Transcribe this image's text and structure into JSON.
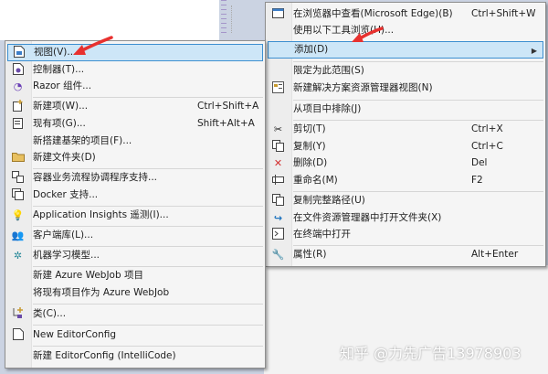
{
  "left_menu": {
    "items": [
      {
        "icon": "view-icon",
        "label": "视图(V)...",
        "shortcut": ""
      },
      {
        "icon": "controller-icon",
        "label": "控制器(T)...",
        "shortcut": ""
      },
      {
        "icon": "razor-icon",
        "label": "Razor 组件...",
        "shortcut": ""
      },
      {
        "icon": "new-item-icon",
        "label": "新建项(W)...",
        "shortcut": "Ctrl+Shift+A"
      },
      {
        "icon": "existing-item-icon",
        "label": "现有项(G)...",
        "shortcut": "Shift+Alt+A"
      },
      {
        "icon": "",
        "label": "新搭建基架的项目(F)...",
        "shortcut": ""
      },
      {
        "icon": "folder-icon",
        "label": "新建文件夹(D)",
        "shortcut": ""
      },
      {
        "icon": "orchestration-icon",
        "label": "容器业务流程协调程序支持...",
        "shortcut": ""
      },
      {
        "icon": "docker-icon",
        "label": "Docker 支持...",
        "shortcut": ""
      },
      {
        "icon": "insights-icon",
        "label": "Application Insights 遥测(I)...",
        "shortcut": ""
      },
      {
        "icon": "client-lib-icon",
        "label": "客户端库(L)...",
        "shortcut": ""
      },
      {
        "icon": "ml-model-icon",
        "label": "机器学习模型...",
        "shortcut": ""
      },
      {
        "icon": "",
        "label": "新建 Azure WebJob 项目",
        "shortcut": ""
      },
      {
        "icon": "",
        "label": "将现有项目作为 Azure WebJob",
        "shortcut": ""
      },
      {
        "icon": "class-icon",
        "label": "类(C)...",
        "shortcut": ""
      },
      {
        "icon": "editorconfig-icon",
        "label": "New EditorConfig",
        "shortcut": ""
      },
      {
        "icon": "",
        "label": "新建 EditorConfig (IntelliCode)",
        "shortcut": ""
      }
    ]
  },
  "right_menu": {
    "items": [
      {
        "icon": "browser-icon",
        "label": "在浏览器中查看(Microsoft Edge)(B)",
        "shortcut": "Ctrl+Shift+W"
      },
      {
        "icon": "",
        "label": "使用以下工具浏览(H)...",
        "shortcut": ""
      },
      {
        "icon": "",
        "label": "添加(D)",
        "shortcut": ""
      },
      {
        "icon": "",
        "label": "限定为此范围(S)",
        "shortcut": ""
      },
      {
        "icon": "solution-view-icon",
        "label": "新建解决方案资源管理器视图(N)",
        "shortcut": ""
      },
      {
        "icon": "",
        "label": "从项目中排除(J)",
        "shortcut": ""
      },
      {
        "icon": "cut-icon",
        "label": "剪切(T)",
        "shortcut": "Ctrl+X"
      },
      {
        "icon": "copy-icon",
        "label": "复制(Y)",
        "shortcut": "Ctrl+C"
      },
      {
        "icon": "delete-icon",
        "label": "删除(D)",
        "shortcut": "Del"
      },
      {
        "icon": "rename-icon",
        "label": "重命名(M)",
        "shortcut": "F2"
      },
      {
        "icon": "copy-path-icon",
        "label": "复制完整路径(U)",
        "shortcut": ""
      },
      {
        "icon": "open-folder-icon",
        "label": "在文件资源管理器中打开文件夹(X)",
        "shortcut": ""
      },
      {
        "icon": "terminal-icon",
        "label": "在终端中打开",
        "shortcut": ""
      },
      {
        "icon": "properties-icon",
        "label": "属性(R)",
        "shortcut": "Alt+Enter"
      }
    ]
  },
  "annotation_color": "#e8312f",
  "highlight_color": "#cde6f7",
  "watermark": "知乎 @力先广告13978903"
}
